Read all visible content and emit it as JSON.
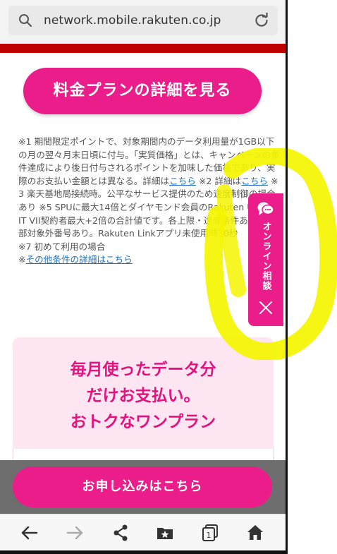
{
  "browser": {
    "url": "network.mobile.rakuten.co.jp",
    "icons": {
      "search": "search-icon",
      "reload": "reload-icon"
    }
  },
  "plan_button": {
    "label": "料金プランの詳細を見る"
  },
  "notes": {
    "part1": "※1 期間限定ポイントで、対象期間内のデータ利用量が1GB以下の月の翌々月末日頃に付与。「実質価格」とは、キャンペーンの条件達成により後日付与されるポイントを加味した価格であり、実際のお支払い金額とは異なる。詳細は",
    "link1": "こちら",
    "part2": " ※2 詳細は",
    "link2": "こちら",
    "part3": " ※3 楽天基地局接続時。公平なサービス提供のため速度制御の場合あり ※5 SPUに最大14倍とダイヤモンド会員のRakuten UN-LIMIT VII契約者最大+2倍の合計値です。各上限・達成条件あり ※一部対象外番号あり。Rakuten Linkアプリ未使用時30秒",
    "part4": "※7 初めて利用の場合",
    "more_prefix": "※",
    "more_link": "その他条件の詳細はこちら"
  },
  "promo": {
    "line1": "毎月使ったデータ分",
    "line2": "だけお支払い。",
    "line3": "おトクなワンプラン"
  },
  "apply_button": {
    "label": "お申し込みはこちら"
  },
  "side_tab": {
    "label": "オンライン相談",
    "icon": "chat-bubble-icon",
    "close_icon": "close-icon"
  },
  "nav": {
    "items": [
      "back-icon",
      "forward-icon",
      "share-icon",
      "bookmark-icon",
      "tabs-icon",
      "home-icon"
    ],
    "tab_count": "1"
  },
  "colors": {
    "brand_magenta": "#eb1d8b",
    "rakuten_red": "#bf0000",
    "highlight_yellow": "#f5f500",
    "link_blue": "#1f6fb8"
  }
}
